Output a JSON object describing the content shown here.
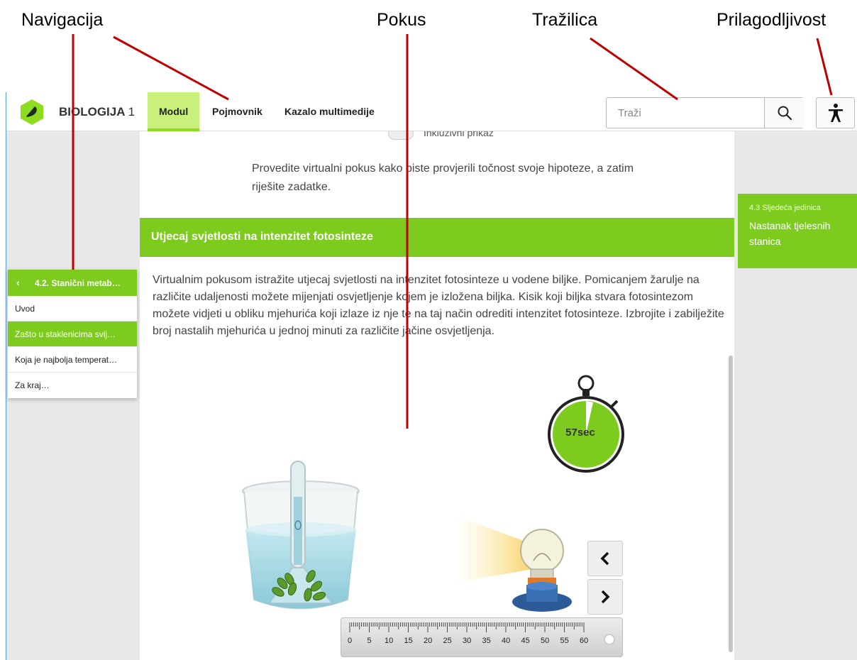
{
  "annotations": {
    "navigation": "Navigacija",
    "experiment": "Pokus",
    "search": "Tražilica",
    "accessibility": "Prilagodljivost"
  },
  "header": {
    "brand": "BIOLOGIJA",
    "brand_number": "1",
    "tabs": [
      {
        "label": "Modul",
        "active": true
      },
      {
        "label": "Pojmovnik",
        "active": false
      },
      {
        "label": "Kazalo multimedije",
        "active": false
      }
    ],
    "search_placeholder": "Traži",
    "search_icon": "magnifier-icon",
    "accessibility_icon": "accessibility-person-icon"
  },
  "content": {
    "toggle_label": "Inkluzivni prikaz",
    "intro": "Provedite virtualni pokus kako biste provjerili točnost svoje hipoteze, a zatim riješite zadatke.",
    "section_title": "Utjecaj svjetlosti na intenzitet fotosinteze",
    "description": "Virtualnim pokusom istražite utjecaj svjetlosti na intenzitet fotosinteze u vodene biljke. Pomicanjem žarulje na različite udaljenosti možete mijenjati osvjetljenje kojem je izložena biljka. Kisik koji biljka stvara fotosintezom možete vidjeti u obliku mjehurića koji izlaze iz nje te na taj način odrediti intenzitet fotosinteze. Izbrojite i zabilježite broj nastalih mjehurića u jednoj minuti za različite jačine osvjetljenja."
  },
  "sidebar": {
    "header": "4.2. Stanični metab…",
    "items": [
      {
        "label": "Uvod",
        "active": false
      },
      {
        "label": "Zašto u staklenicima svij…",
        "active": true
      },
      {
        "label": "Koja je najbolja temperat…",
        "active": false
      },
      {
        "label": "Za kraj…",
        "active": false
      }
    ]
  },
  "next_unit": {
    "subtitle": "4.3 Sljedeća jedinica",
    "title": "Nastanak tjelesnih stanica"
  },
  "experiment": {
    "timer_text": "57sec",
    "ruler_labels": [
      "0",
      "5",
      "10",
      "15",
      "20",
      "25",
      "30",
      "35",
      "40",
      "45",
      "50",
      "55",
      "60"
    ],
    "colors": {
      "accent": "#7ecb20",
      "timer_green": "#7ecb20",
      "lamp_base": "#2d5b9a"
    }
  }
}
